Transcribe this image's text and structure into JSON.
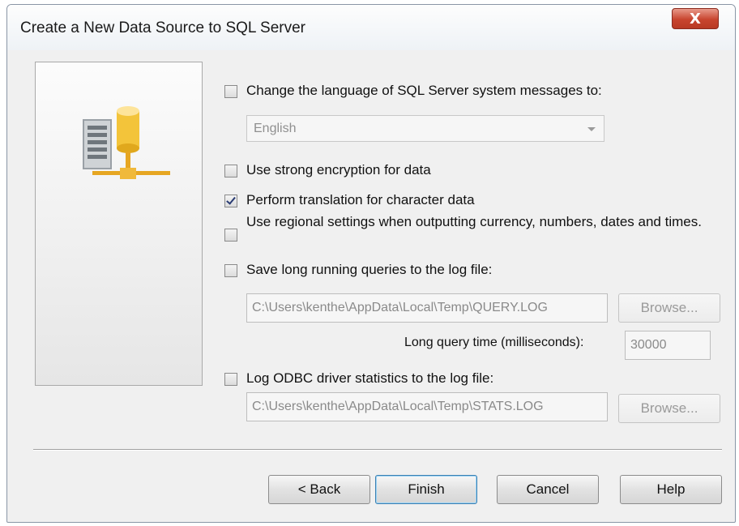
{
  "window": {
    "title": "Create a New Data Source to SQL Server",
    "close_label": "X"
  },
  "options": {
    "change_language": {
      "label": "Change the language of SQL Server system messages to:",
      "checked": false
    },
    "language_select": {
      "value": "English",
      "enabled": false
    },
    "strong_encryption": {
      "label": "Use strong encryption for data",
      "checked": false
    },
    "translation": {
      "label": "Perform translation for character data",
      "checked": true
    },
    "regional_settings": {
      "label": "Use regional settings when outputting currency, numbers, dates and times.",
      "checked": false
    },
    "long_queries": {
      "label": "Save long running queries to the log file:",
      "checked": false
    },
    "query_log_path": {
      "value": "C:\\Users\\kenthe\\AppData\\Local\\Temp\\QUERY.LOG"
    },
    "query_browse": {
      "label": "Browse..."
    },
    "long_query_time": {
      "label": "Long query time (milliseconds):",
      "value": "30000"
    },
    "odbc_stats": {
      "label": "Log ODBC driver statistics to the log file:",
      "checked": false
    },
    "stats_log_path": {
      "value": "C:\\Users\\kenthe\\AppData\\Local\\Temp\\STATS.LOG"
    },
    "stats_browse": {
      "label": "Browse..."
    }
  },
  "buttons": {
    "back": "< Back",
    "finish": "Finish",
    "cancel": "Cancel",
    "help": "Help"
  },
  "icons": {
    "sidepanel": "server-database-icon"
  },
  "colors": {
    "close_red": "#c8442e",
    "check_mark": "#2a3c73",
    "default_button_border": "#3c7fb1"
  }
}
